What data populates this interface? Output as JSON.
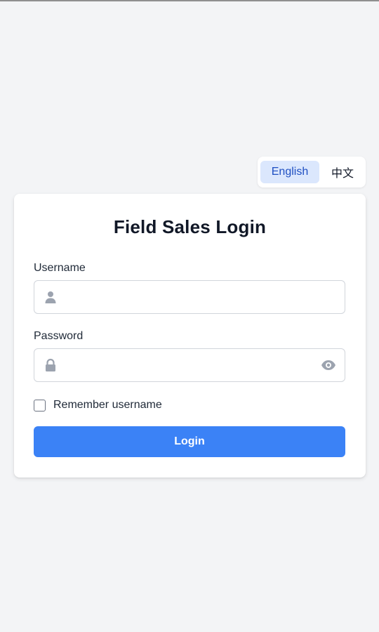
{
  "language_switch": {
    "options": [
      {
        "label": "English",
        "active": true
      },
      {
        "label": "中文",
        "active": false
      }
    ]
  },
  "login_form": {
    "title": "Field Sales Login",
    "username": {
      "label": "Username",
      "value": "",
      "placeholder": "",
      "icon": "user-icon"
    },
    "password": {
      "label": "Password",
      "value": "",
      "placeholder": "",
      "icon": "lock-icon",
      "toggle_icon": "eye-icon"
    },
    "remember": {
      "label": "Remember username",
      "checked": false
    },
    "submit_label": "Login"
  },
  "colors": {
    "page_background": "#f3f4f6",
    "primary": "#3b82f6",
    "active_language_bg": "#dbe7fd",
    "active_language_text": "#1e4fc2",
    "icon": "#9ca3af"
  }
}
